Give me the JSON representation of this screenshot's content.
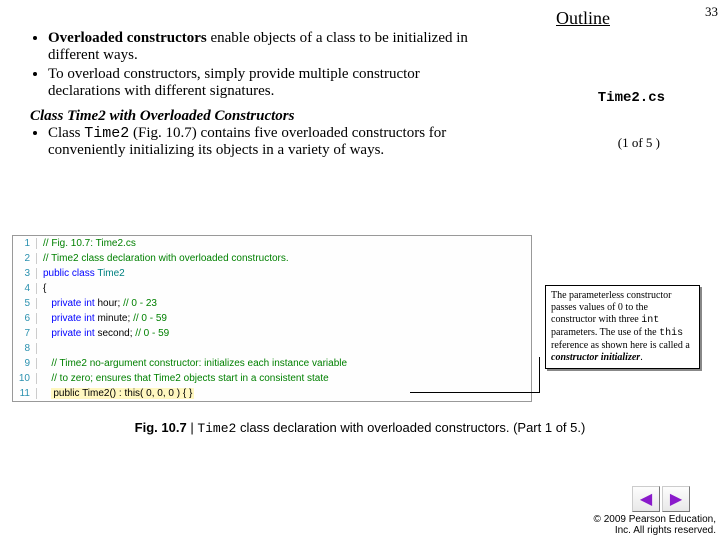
{
  "header": {
    "outline": "Outline",
    "page_number": "33"
  },
  "sidebar": {
    "file_label": "Time2.cs",
    "page_of": "(1 of 5 )"
  },
  "content": {
    "bullets": [
      {
        "pre": "",
        "bold": "Overloaded constructors",
        "post": " enable objects of a class to be initialized in different ways."
      },
      {
        "pre": "To overload constructors, simply provide multiple constructor declarations with different signatures.",
        "bold": "",
        "post": ""
      }
    ],
    "subhead_italic": "Class Time2 with Overloaded Constructors",
    "sub_bullet_pre": "Class ",
    "sub_bullet_code": "Time2",
    "sub_bullet_post": " (Fig. 10.7) contains five overloaded constructors for conveniently initializing its objects in a variety of ways."
  },
  "code": {
    "lines": [
      {
        "n": "1",
        "seg": [
          {
            "t": "// Fig. 10.7: Time2.cs",
            "cls": "c-comment"
          }
        ]
      },
      {
        "n": "2",
        "seg": [
          {
            "t": "// Time2 class declaration with overloaded constructors.",
            "cls": "c-comment"
          }
        ]
      },
      {
        "n": "3",
        "seg": [
          {
            "t": "public",
            "cls": "c-kw"
          },
          {
            "t": " "
          },
          {
            "t": "class",
            "cls": "c-kw"
          },
          {
            "t": " "
          },
          {
            "t": "Time2",
            "cls": "c-type"
          }
        ]
      },
      {
        "n": "4",
        "seg": [
          {
            "t": "{"
          }
        ]
      },
      {
        "n": "5",
        "seg": [
          {
            "t": "   "
          },
          {
            "t": "private",
            "cls": "c-kw"
          },
          {
            "t": " "
          },
          {
            "t": "int",
            "cls": "c-kw"
          },
          {
            "t": " hour; "
          },
          {
            "t": "// 0 - 23",
            "cls": "c-comment"
          }
        ]
      },
      {
        "n": "6",
        "seg": [
          {
            "t": "   "
          },
          {
            "t": "private",
            "cls": "c-kw"
          },
          {
            "t": " "
          },
          {
            "t": "int",
            "cls": "c-kw"
          },
          {
            "t": " minute; "
          },
          {
            "t": "// 0 - 59",
            "cls": "c-comment"
          }
        ]
      },
      {
        "n": "7",
        "seg": [
          {
            "t": "   "
          },
          {
            "t": "private",
            "cls": "c-kw"
          },
          {
            "t": " "
          },
          {
            "t": "int",
            "cls": "c-kw"
          },
          {
            "t": " second; "
          },
          {
            "t": "// 0 - 59",
            "cls": "c-comment"
          }
        ]
      },
      {
        "n": "8",
        "seg": [
          {
            "t": ""
          }
        ]
      },
      {
        "n": "9",
        "seg": [
          {
            "t": "   "
          },
          {
            "t": "// Time2 no-argument constructor: initializes each instance variable",
            "cls": "c-comment"
          }
        ]
      },
      {
        "n": "10",
        "seg": [
          {
            "t": "   "
          },
          {
            "t": "// to zero; ensures that Time2 objects start in a consistent state",
            "cls": "c-comment"
          }
        ]
      },
      {
        "n": "11",
        "seg": [
          {
            "t": "   "
          },
          {
            "t": "public Time2() : this( 0, 0, 0 ) { }",
            "cls": "c-hl"
          }
        ]
      }
    ]
  },
  "annotation": {
    "text_pre": "The parameterless constructor passes values of 0 to the constructor with three ",
    "code1": "int",
    "text_mid": " parameters. The use of the ",
    "code2": "this",
    "text_post": " reference as shown here is called a ",
    "bold_term": "constructor initializer",
    "text_end": "."
  },
  "figure": {
    "label_bold": "Fig. 10.7",
    "label_sep": " | ",
    "label_code": "Time2",
    "label_rest": " class declaration with overloaded constructors. (Part 1 of 5.)"
  },
  "nav": {
    "prev": "◀",
    "next": "▶"
  },
  "footer": {
    "line1": "© 2009 Pearson Education,",
    "line2": "Inc.  All rights reserved."
  }
}
